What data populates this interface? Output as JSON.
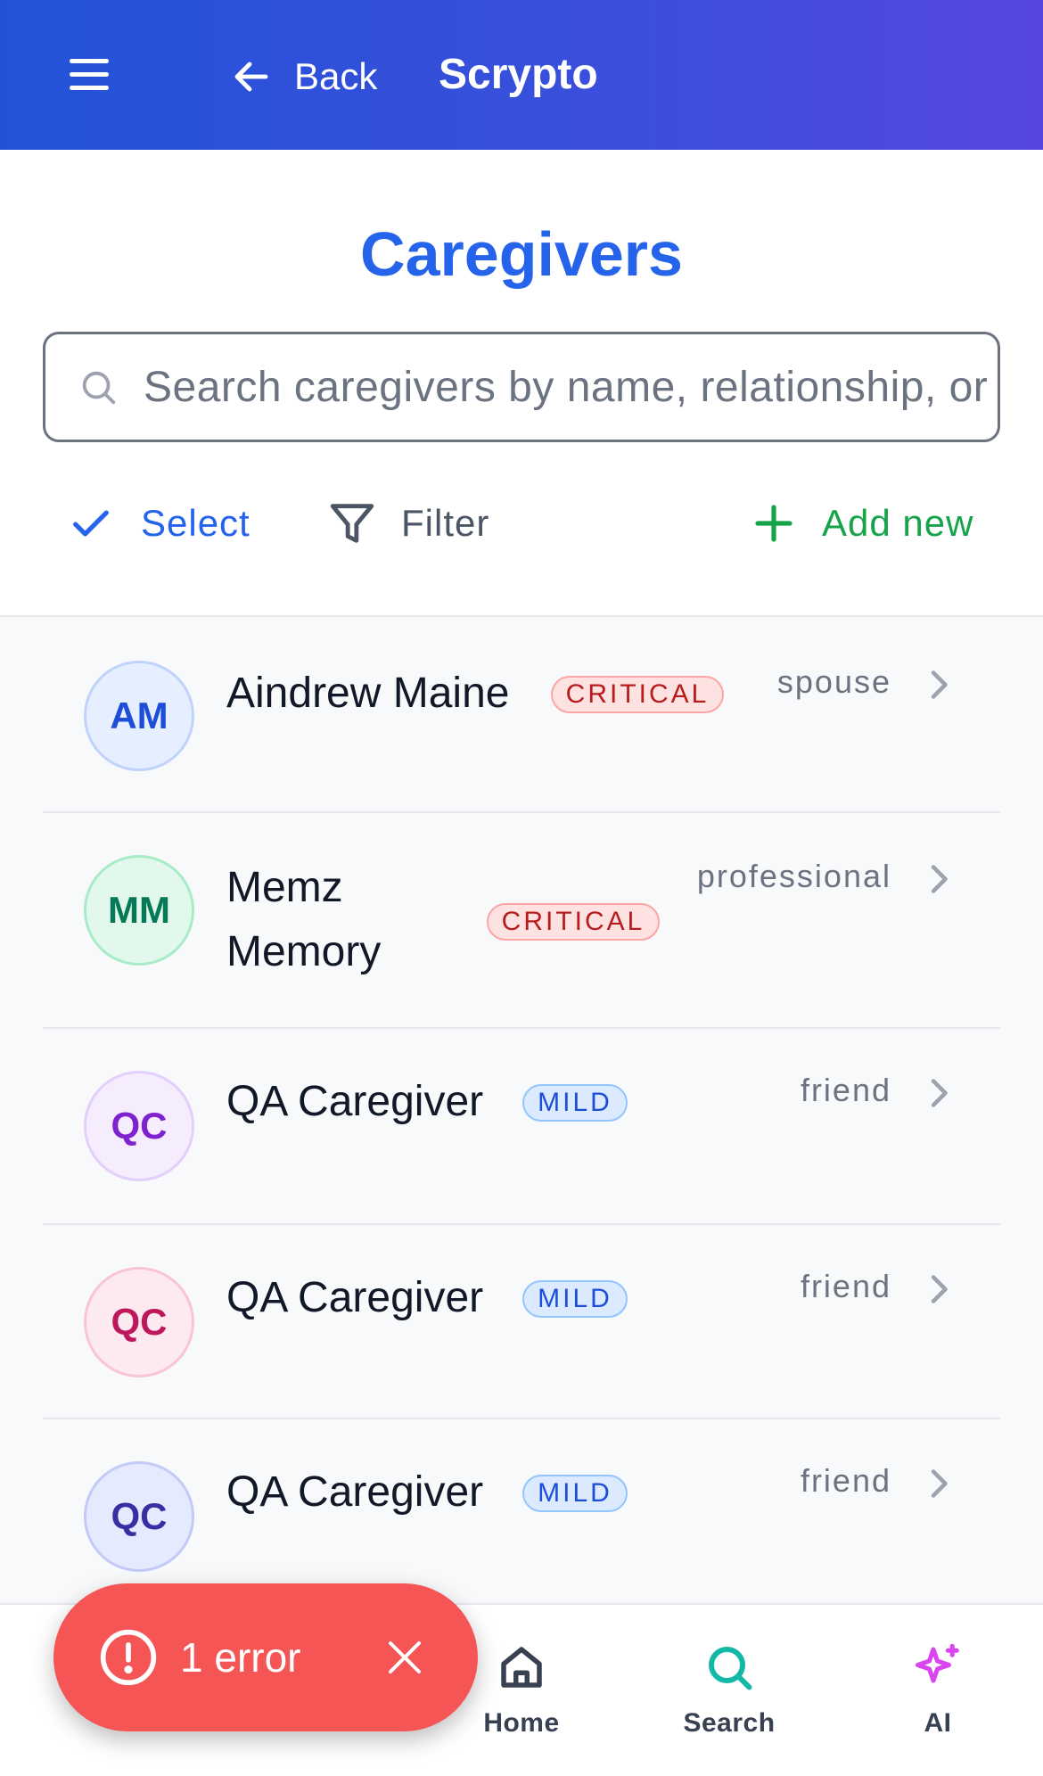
{
  "header": {
    "back_label": "Back",
    "app_title": "Scrypto"
  },
  "page": {
    "title": "Caregivers"
  },
  "search": {
    "placeholder": "Search caregivers by name, relationship, or specialty",
    "value": ""
  },
  "toolbar": {
    "select_label": "Select",
    "filter_label": "Filter",
    "add_label": "Add new"
  },
  "caregivers": [
    {
      "initials": "AM",
      "name": "Aindrew Maine",
      "severity": "CRITICAL",
      "relationship": "spouse",
      "avatar_bg": "#e6efff",
      "avatar_border": "#bfd3fb",
      "avatar_text": "#1d4ed8"
    },
    {
      "initials": "MM",
      "name_line1": "Memz",
      "name_line2": "Memory",
      "severity": "CRITICAL",
      "relationship": "professional",
      "avatar_bg": "#e3f8ec",
      "avatar_border": "#a7ecc6",
      "avatar_text": "#047857"
    },
    {
      "initials": "QC",
      "name": "QA Caregiver",
      "severity": "MILD",
      "relationship": "friend",
      "avatar_bg": "#f5ecfe",
      "avatar_border": "#e3cffb",
      "avatar_text": "#7e22ce"
    },
    {
      "initials": "QC",
      "name": "QA Caregiver",
      "severity": "MILD",
      "relationship": "friend",
      "avatar_bg": "#fdeaf1",
      "avatar_border": "#f8c4d6",
      "avatar_text": "#be185d"
    },
    {
      "initials": "QC",
      "name": "QA Caregiver",
      "severity": "MILD",
      "relationship": "friend",
      "avatar_bg": "#e6eafe",
      "avatar_border": "#c2cbf8",
      "avatar_text": "#3730a3"
    }
  ],
  "bottom_nav": {
    "items": [
      {
        "label": "Home",
        "icon": "home-icon",
        "color": "#374151"
      },
      {
        "label": "Search",
        "icon": "search-icon",
        "color": "#14b8a6"
      },
      {
        "label": "AI",
        "icon": "sparkle-icon",
        "color": "#d946ef"
      }
    ]
  },
  "error_toast": {
    "text": "1 error",
    "color": "#f55555"
  },
  "colors": {
    "brand": "#2563eb",
    "header_gradient_start": "#2352d8",
    "header_gradient_end": "#5647e0",
    "add_green": "#16a34a"
  }
}
